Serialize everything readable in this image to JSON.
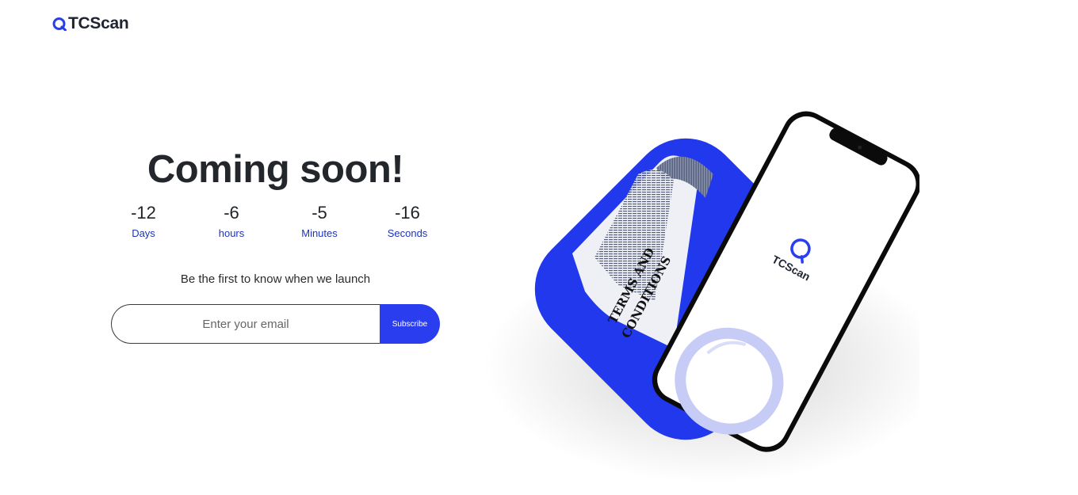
{
  "brand": {
    "name": "TCScan",
    "accent": "#2a3ef0"
  },
  "headline": "Coming soon!",
  "countdown": [
    {
      "value": "-12",
      "label": "Days"
    },
    {
      "value": "-6",
      "label": "hours"
    },
    {
      "value": "-5",
      "label": "Minutes"
    },
    {
      "value": "-16",
      "label": "Seconds"
    }
  ],
  "tagline": "Be the first to know when we launch",
  "subscribe": {
    "placeholder": "Enter your email",
    "button": "Subscribe"
  },
  "illustration": {
    "document_title": "TERMS AND CONDITIONS",
    "phone_app_name": "TCScan"
  }
}
